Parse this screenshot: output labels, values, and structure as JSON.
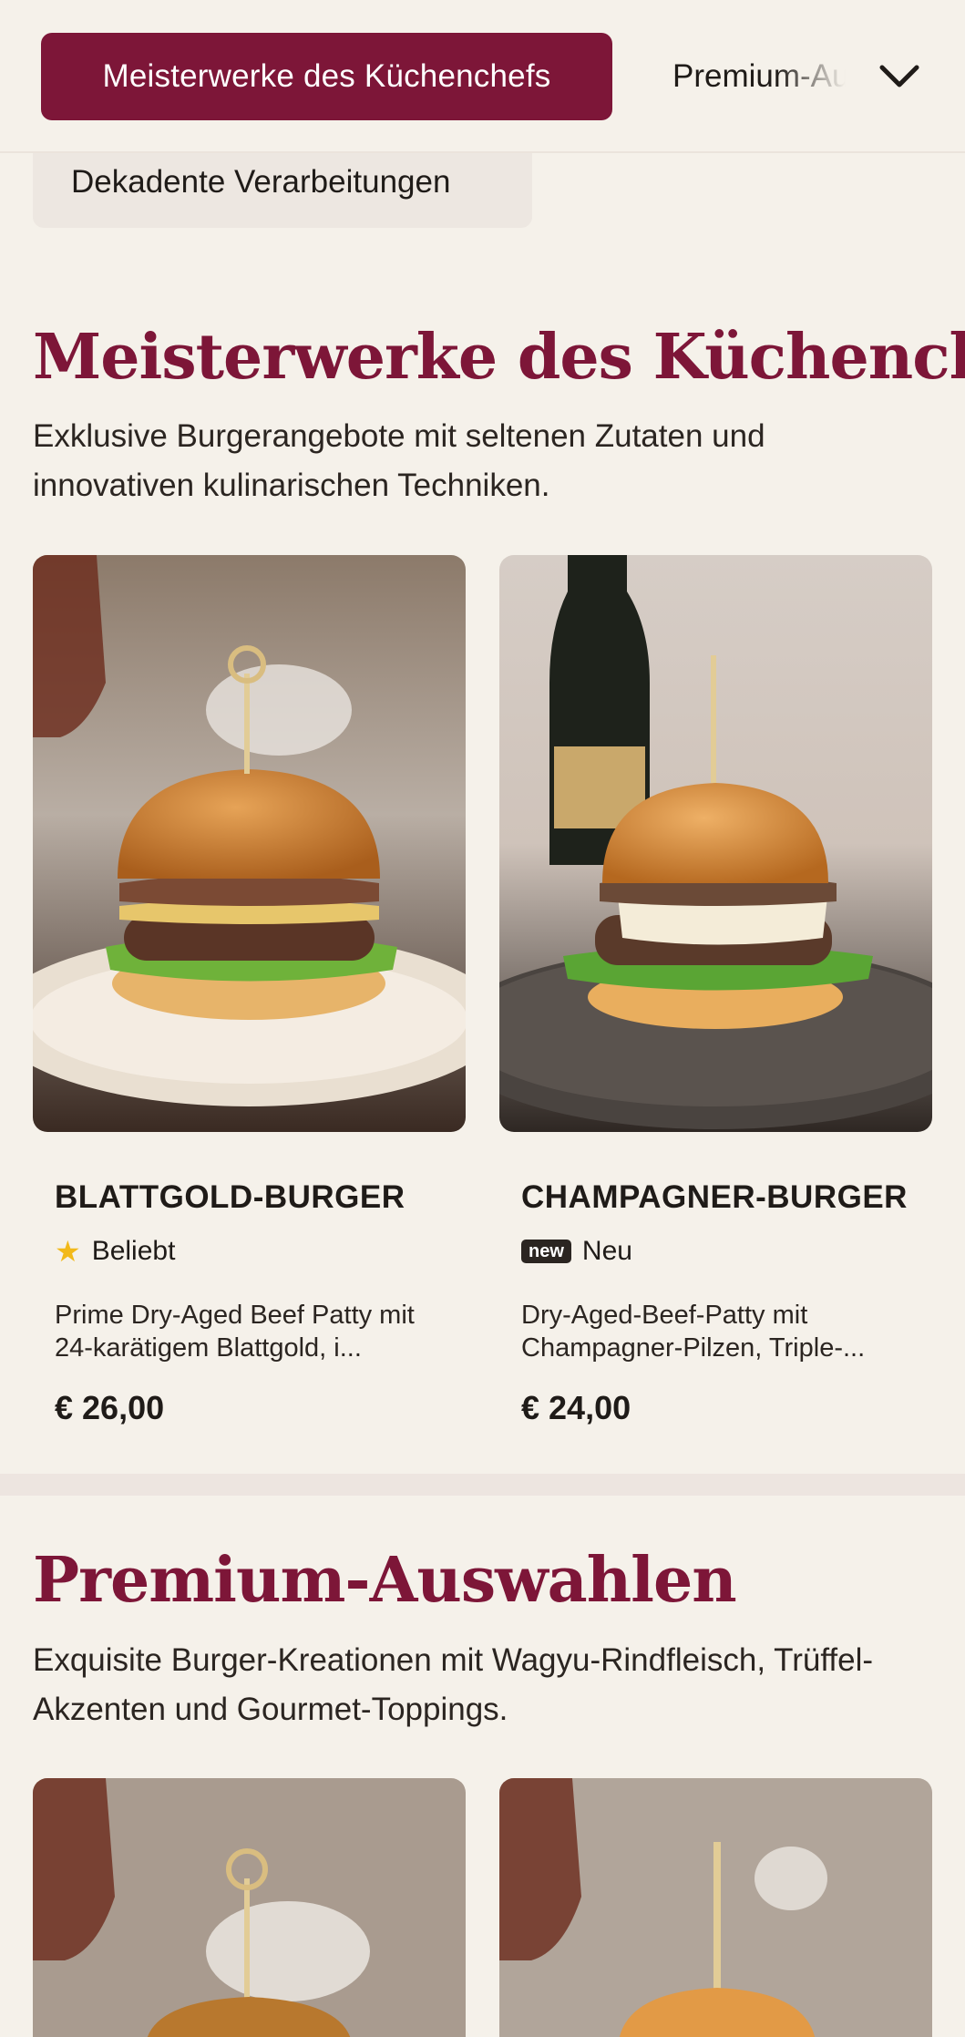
{
  "nav": {
    "active_category": "Meisterwerke des Küchenchefs",
    "next_category": "Premium-Auswahlen",
    "second_row_category": "Dekadente Verarbeitungen",
    "chevron_icon": "chevron-down-icon"
  },
  "sections": [
    {
      "title": "Meisterwerke des Küchenchefs",
      "description": "Exklusive Burgerangebote mit seltenen Zutaten und innovativen kulinarischen Techniken.",
      "items": [
        {
          "name": "BLATTGOLD-BURGER",
          "badge_icon": "star-icon",
          "badge_text": "Beliebt",
          "description": "Prime Dry-Aged Beef Patty mit 24-karätigem Blattgold, i...",
          "price": "€ 26,00"
        },
        {
          "name": "CHAMPAGNER-BURGER",
          "badge_tag": "new",
          "badge_text": "Neu",
          "description": "Dry-Aged-Beef-Patty mit Champagner-Pilzen, Triple-...",
          "price": "€ 24,00"
        }
      ]
    },
    {
      "title": "Premium-Auswahlen",
      "description": "Exquisite Burger-Kreationen mit Wagyu-Rindfleisch, Trüffel-Akzenten und Gourmet-Toppings."
    }
  ],
  "colors": {
    "accent": "#7d1638",
    "background": "#f5f1ea",
    "star": "#f2b91a"
  }
}
